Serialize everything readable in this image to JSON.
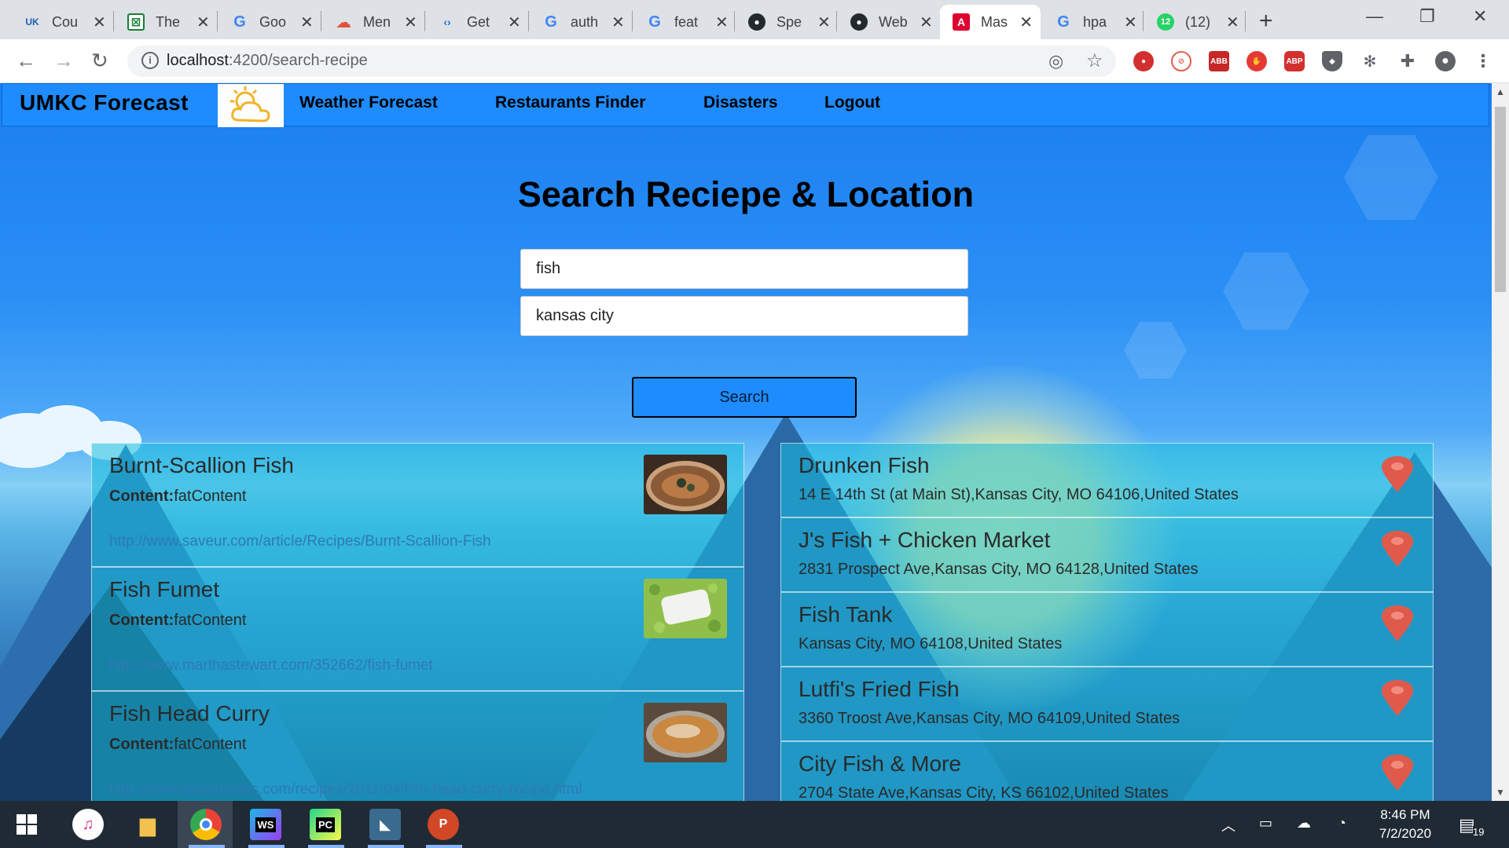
{
  "browser": {
    "tabs": [
      {
        "title": "Cou",
        "icon": "umkc-icon"
      },
      {
        "title": "The",
        "icon": "sheets-icon"
      },
      {
        "title": "Goo",
        "icon": "google-icon"
      },
      {
        "title": "Men",
        "icon": "meetup-icon"
      },
      {
        "title": "Get",
        "icon": "code-icon"
      },
      {
        "title": "auth",
        "icon": "google-icon"
      },
      {
        "title": "feat",
        "icon": "google-icon"
      },
      {
        "title": "Spe",
        "icon": "github-icon"
      },
      {
        "title": "Web",
        "icon": "github-icon"
      },
      {
        "title": "Mas",
        "icon": "angular-icon",
        "active": true
      },
      {
        "title": "hpa",
        "icon": "google-icon"
      },
      {
        "title": "(12)",
        "icon": "whatsapp-icon",
        "badge": "12"
      }
    ],
    "url_host": "localhost",
    "url_path": ":4200/search-recipe"
  },
  "app": {
    "brand": "UMKC Forecast",
    "nav": [
      "Weather Forecast",
      "Restaurants Finder",
      "Disasters",
      "Logout"
    ],
    "title": "Search Reciepe & Location",
    "recipe_query": "fish",
    "location_query": "kansas city",
    "search_label": "Search",
    "content_label": "Content:",
    "recipes": [
      {
        "name": "Burnt-Scallion Fish",
        "content": "fatContent",
        "url": "http://www.saveur.com/article/Recipes/Burnt-Scallion-Fish"
      },
      {
        "name": "Fish Fumet",
        "content": "fatContent",
        "url": "http://www.marthastewart.com/352662/fish-fumet"
      },
      {
        "name": "Fish Head Curry",
        "content": "fatContent",
        "url": "http://www.seriouseats.com/recipes/2011/04/fish-head-curry-recipe.html"
      }
    ],
    "places": [
      {
        "name": "Drunken Fish",
        "address": "14 E 14th St (at Main St),Kansas City, MO 64106,United States"
      },
      {
        "name": "J's Fish + Chicken Market",
        "address": "2831 Prospect Ave,Kansas City, MO 64128,United States"
      },
      {
        "name": "Fish Tank",
        "address": "Kansas City, MO 64108,United States"
      },
      {
        "name": "Lutfi's Fried Fish",
        "address": "3360 Troost Ave,Kansas City, MO 64109,United States"
      },
      {
        "name": "City Fish & More",
        "address": "2704 State Ave,Kansas City, KS 66102,United States"
      }
    ]
  },
  "taskbar": {
    "time": "8:46 PM",
    "date": "7/2/2020",
    "notifications": "19",
    "apps": [
      "itunes-icon",
      "file-explorer-icon",
      "chrome-icon",
      "webstorm-icon",
      "pycharm-icon",
      "mysql-workbench-icon",
      "powerpoint-icon"
    ]
  }
}
